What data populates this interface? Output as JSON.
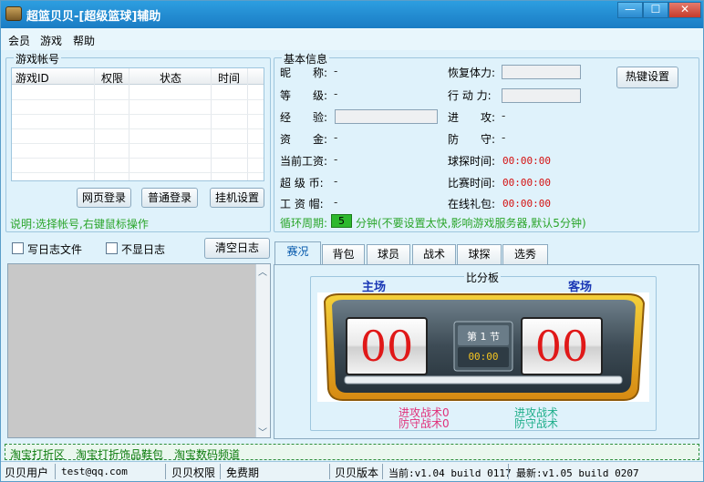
{
  "window": {
    "title": "超篮贝贝-[超级篮球]辅助",
    "controls": {
      "minimize": "—",
      "maximize": "☐",
      "close": "✕"
    }
  },
  "menu": {
    "items": [
      "会员",
      "游戏",
      "帮助"
    ]
  },
  "accounts": {
    "legend": "游戏帐号",
    "columns": [
      "游戏ID",
      "权限",
      "状态",
      "时间"
    ],
    "rows": [],
    "buttons": {
      "web_login": "网页登录",
      "normal_login": "普通登录",
      "afk_settings": "挂机设置"
    },
    "hint": "说明:选择帐号,右键鼠标操作"
  },
  "log": {
    "write_log_label": "写日志文件",
    "hide_log_label": "不显日志",
    "clear_button": "清空日志"
  },
  "basic_info": {
    "legend": "基本信息",
    "nickname_label": "昵　　称:",
    "nickname_value": "-",
    "level_label": "等　　级:",
    "level_value": "-",
    "exp_label": "经　　验:",
    "funds_label": "资　　金:",
    "funds_value": "-",
    "salary_label": "当前工资:",
    "salary_value": "-",
    "coins_label": "超 级 币:",
    "coins_value": "-",
    "cap_label": "工 资 帽:",
    "cap_value": "-",
    "stamina_label": "恢复体力:",
    "action_label": "行 动 力:",
    "attack_label": "进　　攻:",
    "attack_value": "-",
    "defense_label": "防　　守:",
    "defense_value": "-",
    "scout_time_label": "球探时间:",
    "scout_time_value": "00:00:00",
    "match_time_label": "比赛时间:",
    "match_time_value": "00:00:00",
    "gift_label": "在线礼包:",
    "gift_value": "00:00:00",
    "hotkey_button": "热键设置",
    "cycle_label": "循环周期:",
    "cycle_value": "5",
    "cycle_note": "分钟(不要设置太快,影响游戏服务器,默认5分钟)"
  },
  "tabs": [
    "赛况",
    "背包",
    "球员",
    "战术",
    "球探",
    "选秀"
  ],
  "scoreboard": {
    "legend": "比分板",
    "home_label": "主场",
    "away_label": "客场",
    "home_score": "00",
    "away_score": "00",
    "period": "第 1 节",
    "clock": "00:00",
    "home_attack": "进攻战术0",
    "home_defense": "防守战术0",
    "away_attack": "进攻战术",
    "away_defense": "防守战术"
  },
  "links": [
    "淘宝打折区",
    "淘宝打折饰品鞋包",
    "淘宝数码频道"
  ],
  "status": {
    "user_label": "贝贝用户",
    "user_value": "test@qq.com",
    "perm_label": "贝贝权限",
    "perm_value": "免费期",
    "version_label": "贝贝版本",
    "current_version": "当前:v1.04 build 0117",
    "latest_version": "最新:v1.05 build 0207"
  },
  "colors": {
    "accent": "#1a7cc4",
    "timer_red": "#d41010",
    "green_link": "#0a7a0a",
    "cycle_green": "#2db82d"
  }
}
